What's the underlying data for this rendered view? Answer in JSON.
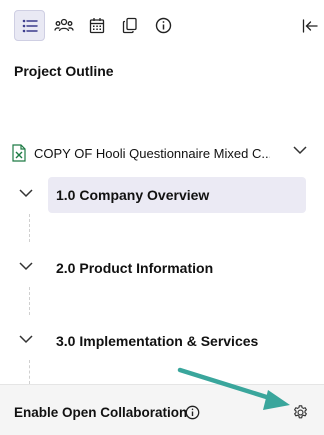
{
  "toolbar": {
    "buttons": [
      {
        "icon": "list-icon",
        "active": true
      },
      {
        "icon": "people-icon",
        "active": false
      },
      {
        "icon": "calendar-icon",
        "active": false
      },
      {
        "icon": "copy-icon",
        "active": false
      },
      {
        "icon": "info-icon",
        "active": false
      }
    ],
    "collapse_icon": "collapse-left-icon"
  },
  "outline": {
    "title": "Project Outline",
    "file": {
      "name": "COPY OF Hooli Questionnaire Mixed C...",
      "icon": "excel-file-icon"
    },
    "sections": [
      {
        "label": "1.0 Company Overview",
        "selected": true
      },
      {
        "label": "2.0 Product Information",
        "selected": false
      },
      {
        "label": "3.0 Implementation & Services",
        "selected": false
      }
    ]
  },
  "footer": {
    "collab_label": "Enable Open Collaboration",
    "info_icon": "info-icon",
    "settings_icon": "gear-icon"
  },
  "colors": {
    "accent": "#3aa69c",
    "selected_bg": "#ebeaf4",
    "excel_green": "#1e7b45",
    "footer_bg": "#f5f5f5"
  }
}
